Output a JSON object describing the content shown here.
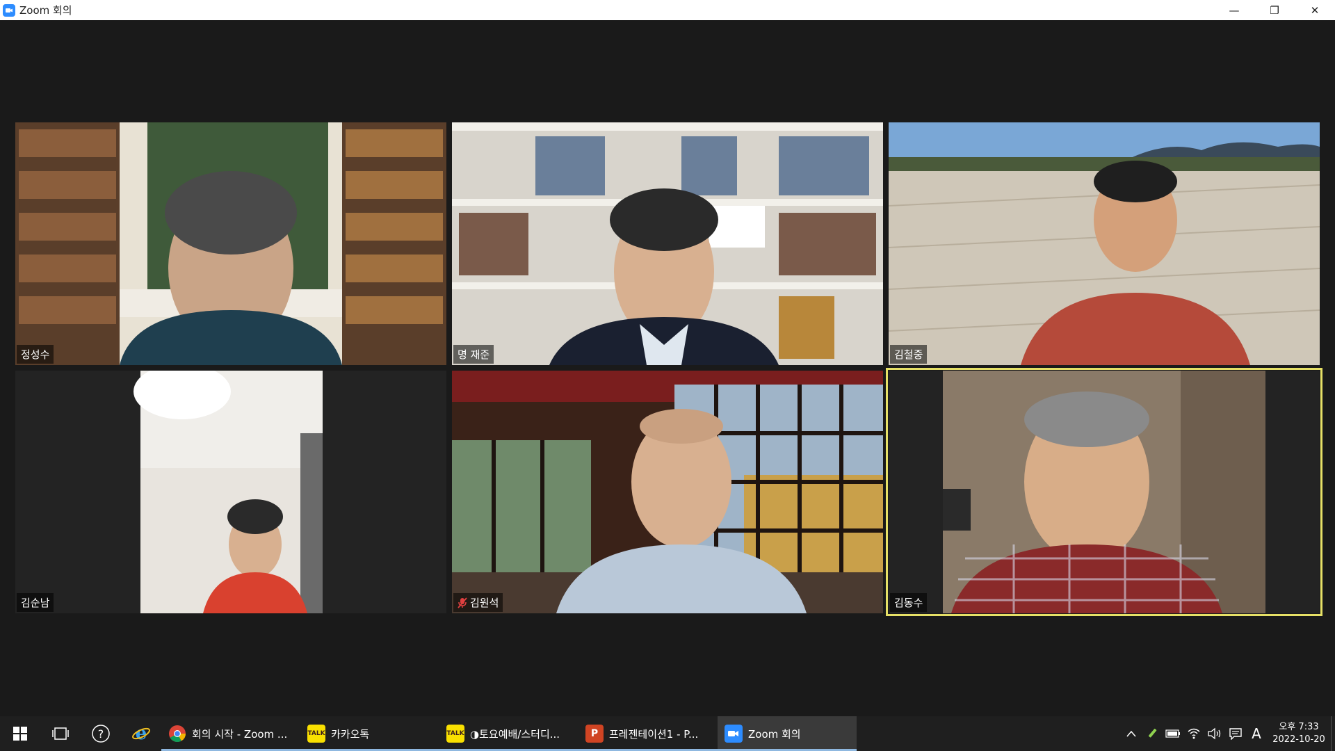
{
  "window": {
    "title": "Zoom 회의",
    "controls": {
      "minimize": "—",
      "restore": "❐",
      "close": "✕"
    }
  },
  "participants": [
    {
      "name": "정성수",
      "muted": false,
      "active_speaker": false
    },
    {
      "name": "명 재준",
      "muted": false,
      "active_speaker": false
    },
    {
      "name": "김철중",
      "muted": false,
      "active_speaker": false
    },
    {
      "name": "김순남",
      "muted": false,
      "active_speaker": false
    },
    {
      "name": "김원석",
      "muted": true,
      "active_speaker": false
    },
    {
      "name": "김동수",
      "muted": false,
      "active_speaker": true
    }
  ],
  "taskbar": {
    "apps": [
      {
        "label": "회의 시작 - Zoom ...",
        "icon": "chrome-icon",
        "icon_color": "#ffffff"
      },
      {
        "label": "카카오톡",
        "icon": "kakaotalk-icon",
        "icon_color": "#f9e000",
        "icon_text": "TALK"
      },
      {
        "label": "◑토요예배/스터디...",
        "icon": "kakaotalk-icon",
        "icon_color": "#f9e000",
        "icon_text": "TALK"
      },
      {
        "label": "프레젠테이션1 - P...",
        "icon": "powerpoint-icon",
        "icon_color": "#d04423",
        "icon_text": "P"
      },
      {
        "label": "Zoom 회의",
        "icon": "zoom-icon",
        "icon_color": "#2d8cff"
      }
    ],
    "tray": {
      "ime": "A",
      "time": "오후 7:33",
      "date": "2022-10-20"
    }
  },
  "colors": {
    "active_speaker_border": "#e6e066",
    "zoom_blue": "#2d8cff",
    "background": "#1a1a1a"
  }
}
